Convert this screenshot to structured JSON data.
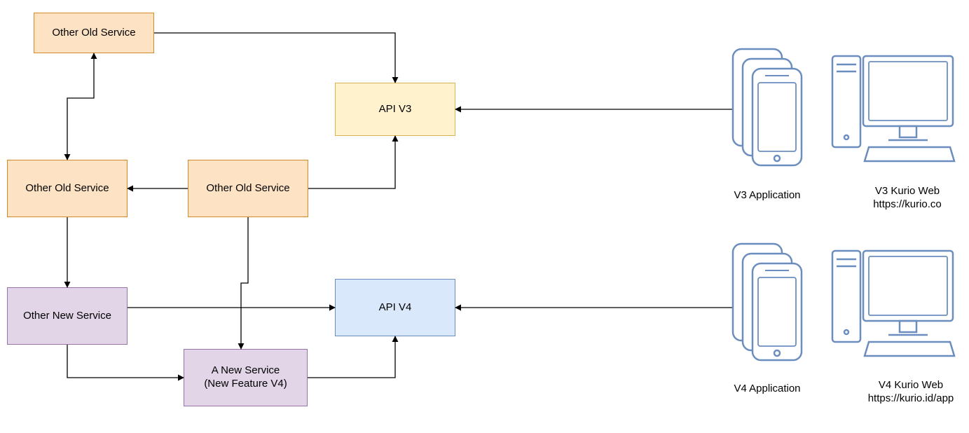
{
  "colors": {
    "orange_fill": "#fde3c4",
    "orange_border": "#d38a2a",
    "yellow_fill": "#fff2cc",
    "yellow_border": "#d6b656",
    "purple_fill": "#e1d5e7",
    "purple_border": "#9673a6",
    "blue_fill": "#dae8fc",
    "blue_border": "#6c8ebf",
    "device_stroke": "#6c8ebf"
  },
  "nodes": {
    "old_svc_top": {
      "text": "Other Old Service"
    },
    "old_svc_left": {
      "text": "Other Old Service"
    },
    "old_svc_mid": {
      "text": "Other Old Service"
    },
    "api_v3": {
      "text": "API V3"
    },
    "new_svc_left": {
      "text": "Other New Service"
    },
    "new_svc_bottom": {
      "text": "A New Service\n(New Feature V4)"
    },
    "api_v4": {
      "text": "API V4"
    }
  },
  "labels": {
    "v3_app": "V3 Application",
    "v3_web": "V3 Kurio Web\nhttps://kurio.co",
    "v4_app": "V4 Application",
    "v4_web": "V4 Kurio Web\nhttps://kurio.id/app"
  }
}
